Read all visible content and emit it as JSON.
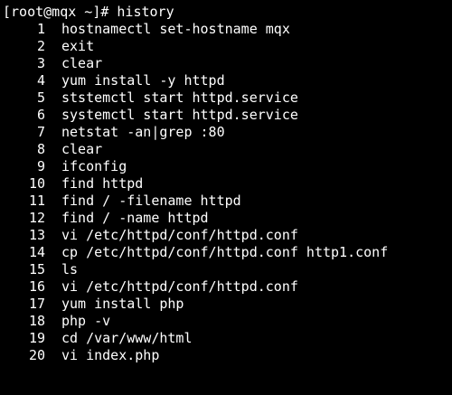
{
  "terminal": {
    "background": "#000000",
    "foreground": "#ffffff",
    "prompt": "[root@mqx ~]#",
    "command": "history",
    "history": [
      {
        "num": "1",
        "cmd": "hostnamectl set-hostname mqx"
      },
      {
        "num": "2",
        "cmd": "exit"
      },
      {
        "num": "3",
        "cmd": "clear"
      },
      {
        "num": "4",
        "cmd": "yum install -y httpd"
      },
      {
        "num": "5",
        "cmd": "ststemctl start httpd.service"
      },
      {
        "num": "6",
        "cmd": "systemctl start httpd.service"
      },
      {
        "num": "7",
        "cmd": "netstat -an|grep :80"
      },
      {
        "num": "8",
        "cmd": "clear"
      },
      {
        "num": "9",
        "cmd": "ifconfig"
      },
      {
        "num": "10",
        "cmd": "find httpd"
      },
      {
        "num": "11",
        "cmd": "find / -filename httpd"
      },
      {
        "num": "12",
        "cmd": "find / -name httpd"
      },
      {
        "num": "13",
        "cmd": "vi /etc/httpd/conf/httpd.conf"
      },
      {
        "num": "14",
        "cmd": "cp /etc/httpd/conf/httpd.conf http1.conf"
      },
      {
        "num": "15",
        "cmd": "ls"
      },
      {
        "num": "16",
        "cmd": "vi /etc/httpd/conf/httpd.conf"
      },
      {
        "num": "17",
        "cmd": "yum install php"
      },
      {
        "num": "18",
        "cmd": "php -v"
      },
      {
        "num": "19",
        "cmd": "cd /var/www/html"
      },
      {
        "num": "20",
        "cmd": "vi index.php"
      }
    ]
  }
}
